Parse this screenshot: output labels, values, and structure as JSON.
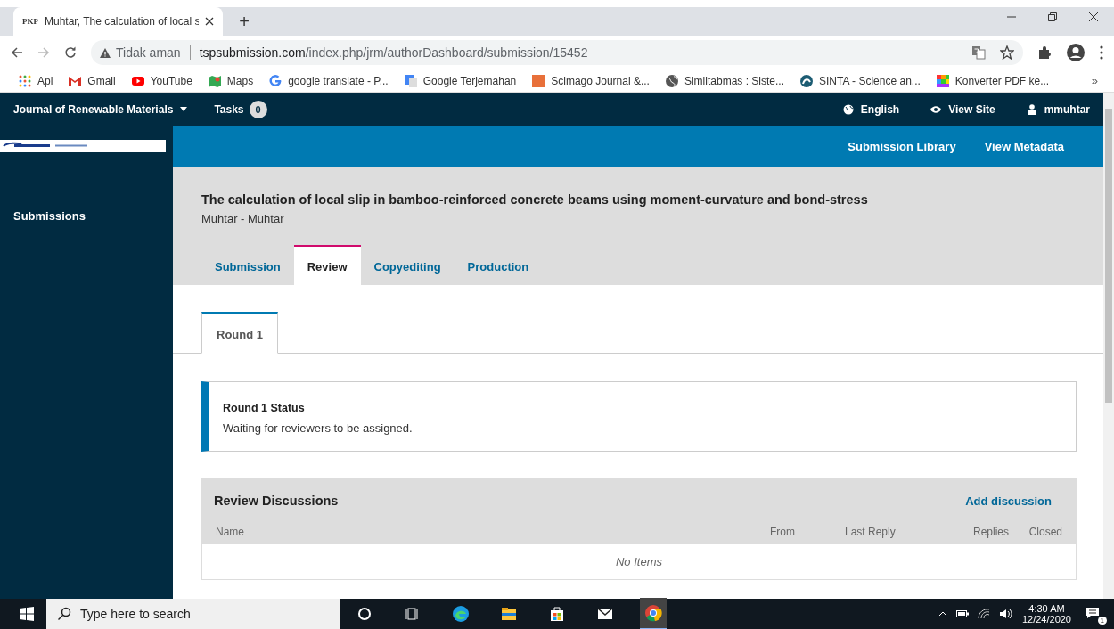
{
  "browser": {
    "tabs": [
      {
        "favicon": "PKP",
        "title": "Muhtar, The calculation of local s",
        "selected": true
      }
    ],
    "new_tab": "+",
    "address": {
      "security": "Tidak aman",
      "host": "tspsubmission.com",
      "path": "/index.php/jrm/authorDashboard/submission/15452"
    },
    "bookmarks": [
      {
        "kind": "apps",
        "label": "Apl"
      },
      {
        "kind": "gmail",
        "label": "Gmail"
      },
      {
        "kind": "youtube",
        "label": "YouTube"
      },
      {
        "kind": "maps",
        "label": "Maps"
      },
      {
        "kind": "google",
        "label": "google translate - P..."
      },
      {
        "kind": "translate",
        "label": "Google Terjemahan"
      },
      {
        "kind": "sjr",
        "label": "Scimago Journal &..."
      },
      {
        "kind": "globe",
        "label": "Simlitabmas : Siste..."
      },
      {
        "kind": "sinta",
        "label": "SINTA - Science an..."
      },
      {
        "kind": "pdf",
        "label": "Konverter PDF ke..."
      }
    ],
    "bookmarks_more": "»"
  },
  "app": {
    "journal": "Journal of Renewable Materials",
    "tasks_label": "Tasks",
    "tasks_count": "0",
    "user_links": [
      {
        "kind": "language",
        "label": "English"
      },
      {
        "kind": "view",
        "label": "View Site"
      },
      {
        "kind": "user",
        "label": "mmuhtar"
      }
    ],
    "sidebar": {
      "items": [
        {
          "label": "Submissions",
          "selected": false
        }
      ]
    },
    "header_links": [
      "Submission Library",
      "View Metadata"
    ],
    "submission": {
      "title": "The calculation of local slip in bamboo-reinforced concrete beams using moment-curvature and bond-stress",
      "authors": "Muhtar - Muhtar"
    },
    "stage_tabs": [
      {
        "label": "Submission",
        "selected": false
      },
      {
        "label": "Review",
        "selected": true
      },
      {
        "label": "Copyediting",
        "selected": false
      },
      {
        "label": "Production",
        "selected": false
      }
    ],
    "round_tabs": [
      {
        "label": "Round 1",
        "selected": true
      }
    ],
    "status": {
      "title": "Round 1 Status",
      "text": "Waiting for reviewers to be assigned."
    },
    "discussions": {
      "title": "Review Discussions",
      "add": "Add discussion",
      "columns": [
        "Name",
        "From",
        "Last Reply",
        "Replies",
        "Closed"
      ],
      "empty": "No Items"
    }
  },
  "taskbar": {
    "search_placeholder": "Type here to search",
    "time": "4:30 AM",
    "date": "12/24/2020",
    "notifications": "1"
  }
}
